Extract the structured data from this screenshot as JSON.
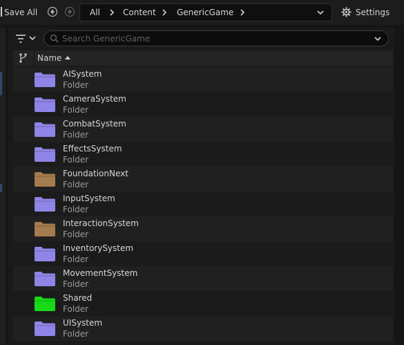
{
  "toolbar": {
    "save_all_label": "Save All",
    "breadcrumb": [
      "All",
      "Content",
      "GenericGame"
    ],
    "settings_label": "Settings"
  },
  "search": {
    "placeholder": "Search GenericGame",
    "value": ""
  },
  "table": {
    "column_name": "Name"
  },
  "colors": {
    "folder_default": "#8f85e6",
    "folder_brown": "#a57c4d",
    "folder_green": "#17d917"
  },
  "items": [
    {
      "name": "AISystem",
      "type": "Folder",
      "color": "#8f85e6"
    },
    {
      "name": "CameraSystem",
      "type": "Folder",
      "color": "#8f85e6"
    },
    {
      "name": "CombatSystem",
      "type": "Folder",
      "color": "#8f85e6"
    },
    {
      "name": "EffectsSystem",
      "type": "Folder",
      "color": "#8f85e6"
    },
    {
      "name": "FoundationNext",
      "type": "Folder",
      "color": "#a57c4d"
    },
    {
      "name": "InputSystem",
      "type": "Folder",
      "color": "#8f85e6"
    },
    {
      "name": "InteractionSystem",
      "type": "Folder",
      "color": "#a57c4d"
    },
    {
      "name": "InventorySystem",
      "type": "Folder",
      "color": "#8f85e6"
    },
    {
      "name": "MovementSystem",
      "type": "Folder",
      "color": "#8f85e6"
    },
    {
      "name": "Shared",
      "type": "Folder",
      "color": "#17d917"
    },
    {
      "name": "UISystem",
      "type": "Folder",
      "color": "#8f85e6"
    }
  ]
}
